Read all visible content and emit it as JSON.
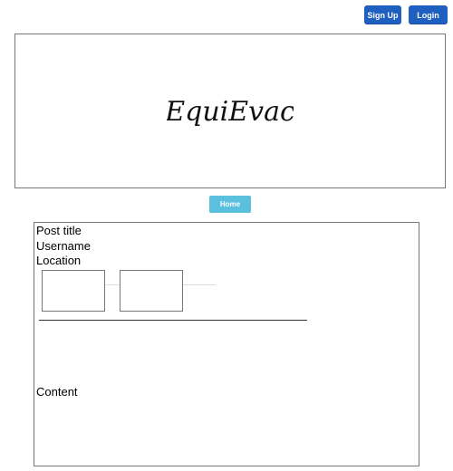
{
  "header": {
    "signup_label": "Sign Up",
    "login_label": "Login",
    "brand_color": "#1f5fbf"
  },
  "banner": {
    "logo_text": "EquiEvac"
  },
  "nav": {
    "home_label": "Home",
    "home_color": "#5bc0de"
  },
  "post": {
    "title": "Post title",
    "username": "Username",
    "location": "Location",
    "content": "Content"
  }
}
